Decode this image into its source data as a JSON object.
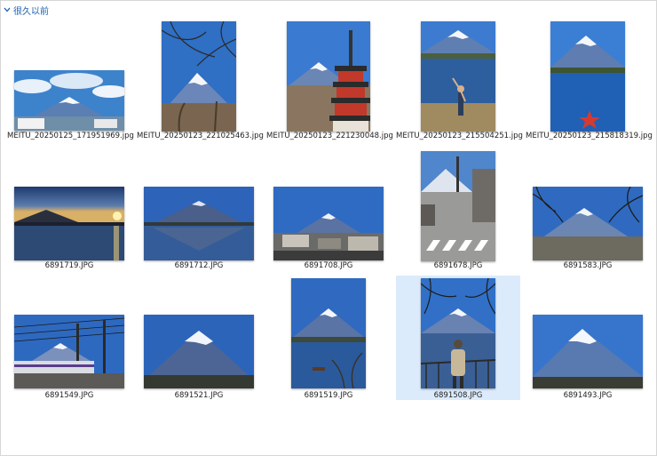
{
  "group": {
    "label": "很久以前"
  },
  "files": [
    {
      "name": "MEITU_20250125_171951969.jpg",
      "scene": "wide-clouds"
    },
    {
      "name": "MEITU_20250123_221025463.jpg",
      "scene": "portrait-branches"
    },
    {
      "name": "MEITU_20250123_221230048.jpg",
      "scene": "portrait-pagoda"
    },
    {
      "name": "MEITU_20250123_215504251.jpg",
      "scene": "portrait-person-lake"
    },
    {
      "name": "MEITU_20250123_215818319.jpg",
      "scene": "portrait-lake-star"
    },
    {
      "name": "6891719.JPG",
      "scene": "sunset"
    },
    {
      "name": "6891712.JPG",
      "scene": "reflection"
    },
    {
      "name": "6891708.JPG",
      "scene": "town"
    },
    {
      "name": "6891678.JPG",
      "scene": "portrait-street"
    },
    {
      "name": "6891583.JPG",
      "scene": "branches-wide"
    },
    {
      "name": "6891549.JPG",
      "scene": "train"
    },
    {
      "name": "6891521.JPG",
      "scene": "mountain-blue"
    },
    {
      "name": "6891519.JPG",
      "scene": "portrait-boat"
    },
    {
      "name": "6891508.JPG",
      "scene": "portrait-person-rail",
      "selected": true
    },
    {
      "name": "6891493.JPG",
      "scene": "mountain-clear"
    }
  ]
}
